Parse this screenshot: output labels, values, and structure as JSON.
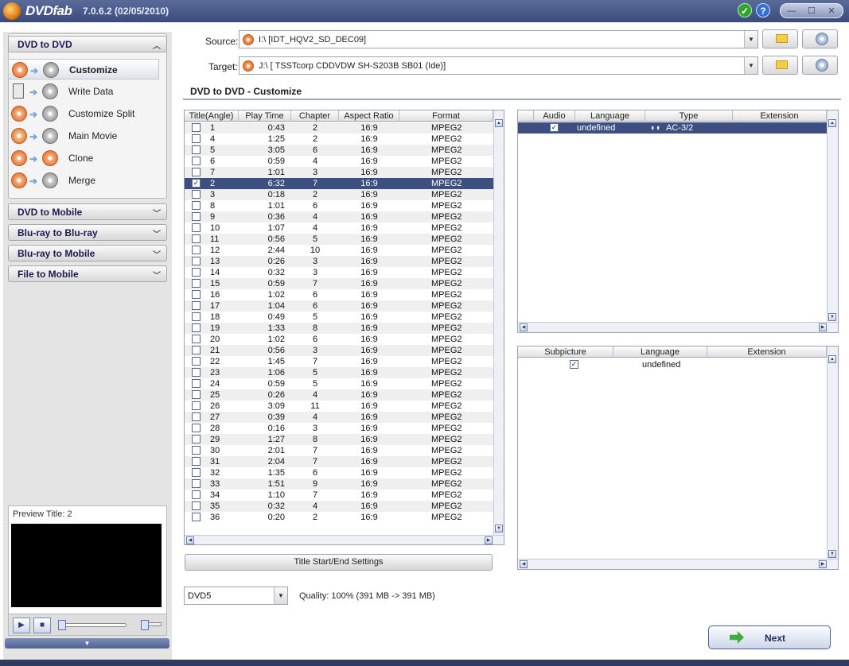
{
  "app": {
    "name": "DVDfab",
    "version": "7.0.6.2 (02/05/2010)"
  },
  "sidebar": {
    "main_category": "DVD to DVD",
    "modes": [
      {
        "label": "Customize",
        "selected": true
      },
      {
        "label": "Write Data",
        "selected": false
      },
      {
        "label": "Customize Split",
        "selected": false
      },
      {
        "label": "Main Movie",
        "selected": false
      },
      {
        "label": "Clone",
        "selected": false
      },
      {
        "label": "Merge",
        "selected": false
      }
    ],
    "categories": [
      "DVD to Mobile",
      "Blu-ray to Blu-ray",
      "Blu-ray to Mobile",
      "File to Mobile"
    ],
    "preview_label": "Preview Title: 2"
  },
  "source": {
    "label": "Source:",
    "value": "I:\\ [IDT_HQV2_SD_DEC09]"
  },
  "target": {
    "label": "Target:",
    "value": "J:\\ [ TSSTcorp CDDVDW SH-S203B SB01 (Ide)]"
  },
  "section_title": "DVD to DVD - Customize",
  "titles": {
    "headers": [
      "Title(Angle)",
      "Play Time",
      "Chapter",
      "Aspect Ratio",
      "Format"
    ],
    "rows": [
      {
        "title": "1",
        "time": "0:43",
        "chapters": "2",
        "aspect": "16:9",
        "format": "MPEG2",
        "checked": false
      },
      {
        "title": "4",
        "time": "1:25",
        "chapters": "2",
        "aspect": "16:9",
        "format": "MPEG2",
        "checked": false
      },
      {
        "title": "5",
        "time": "3:05",
        "chapters": "6",
        "aspect": "16:9",
        "format": "MPEG2",
        "checked": false
      },
      {
        "title": "6",
        "time": "0:59",
        "chapters": "4",
        "aspect": "16:9",
        "format": "MPEG2",
        "checked": false
      },
      {
        "title": "7",
        "time": "1:01",
        "chapters": "3",
        "aspect": "16:9",
        "format": "MPEG2",
        "checked": false
      },
      {
        "title": "2",
        "time": "6:32",
        "chapters": "7",
        "aspect": "16:9",
        "format": "MPEG2",
        "checked": true
      },
      {
        "title": "3",
        "time": "0:18",
        "chapters": "2",
        "aspect": "16:9",
        "format": "MPEG2",
        "checked": false
      },
      {
        "title": "8",
        "time": "1:01",
        "chapters": "6",
        "aspect": "16:9",
        "format": "MPEG2",
        "checked": false
      },
      {
        "title": "9",
        "time": "0:36",
        "chapters": "4",
        "aspect": "16:9",
        "format": "MPEG2",
        "checked": false
      },
      {
        "title": "10",
        "time": "1:07",
        "chapters": "4",
        "aspect": "16:9",
        "format": "MPEG2",
        "checked": false
      },
      {
        "title": "11",
        "time": "0:56",
        "chapters": "5",
        "aspect": "16:9",
        "format": "MPEG2",
        "checked": false
      },
      {
        "title": "12",
        "time": "2:44",
        "chapters": "10",
        "aspect": "16:9",
        "format": "MPEG2",
        "checked": false
      },
      {
        "title": "13",
        "time": "0:26",
        "chapters": "3",
        "aspect": "16:9",
        "format": "MPEG2",
        "checked": false
      },
      {
        "title": "14",
        "time": "0:32",
        "chapters": "3",
        "aspect": "16:9",
        "format": "MPEG2",
        "checked": false
      },
      {
        "title": "15",
        "time": "0:59",
        "chapters": "7",
        "aspect": "16:9",
        "format": "MPEG2",
        "checked": false
      },
      {
        "title": "16",
        "time": "1:02",
        "chapters": "6",
        "aspect": "16:9",
        "format": "MPEG2",
        "checked": false
      },
      {
        "title": "17",
        "time": "1:04",
        "chapters": "6",
        "aspect": "16:9",
        "format": "MPEG2",
        "checked": false
      },
      {
        "title": "18",
        "time": "0:49",
        "chapters": "5",
        "aspect": "16:9",
        "format": "MPEG2",
        "checked": false
      },
      {
        "title": "19",
        "time": "1:33",
        "chapters": "8",
        "aspect": "16:9",
        "format": "MPEG2",
        "checked": false
      },
      {
        "title": "20",
        "time": "1:02",
        "chapters": "6",
        "aspect": "16:9",
        "format": "MPEG2",
        "checked": false
      },
      {
        "title": "21",
        "time": "0:56",
        "chapters": "3",
        "aspect": "16:9",
        "format": "MPEG2",
        "checked": false
      },
      {
        "title": "22",
        "time": "1:45",
        "chapters": "7",
        "aspect": "16:9",
        "format": "MPEG2",
        "checked": false
      },
      {
        "title": "23",
        "time": "1:06",
        "chapters": "5",
        "aspect": "16:9",
        "format": "MPEG2",
        "checked": false
      },
      {
        "title": "24",
        "time": "0:59",
        "chapters": "5",
        "aspect": "16:9",
        "format": "MPEG2",
        "checked": false
      },
      {
        "title": "25",
        "time": "0:26",
        "chapters": "4",
        "aspect": "16:9",
        "format": "MPEG2",
        "checked": false
      },
      {
        "title": "26",
        "time": "3:09",
        "chapters": "11",
        "aspect": "16:9",
        "format": "MPEG2",
        "checked": false
      },
      {
        "title": "27",
        "time": "0:39",
        "chapters": "4",
        "aspect": "16:9",
        "format": "MPEG2",
        "checked": false
      },
      {
        "title": "28",
        "time": "0:16",
        "chapters": "3",
        "aspect": "16:9",
        "format": "MPEG2",
        "checked": false
      },
      {
        "title": "29",
        "time": "1:27",
        "chapters": "8",
        "aspect": "16:9",
        "format": "MPEG2",
        "checked": false
      },
      {
        "title": "30",
        "time": "2:01",
        "chapters": "7",
        "aspect": "16:9",
        "format": "MPEG2",
        "checked": false
      },
      {
        "title": "31",
        "time": "2:04",
        "chapters": "7",
        "aspect": "16:9",
        "format": "MPEG2",
        "checked": false
      },
      {
        "title": "32",
        "time": "1:35",
        "chapters": "6",
        "aspect": "16:9",
        "format": "MPEG2",
        "checked": false
      },
      {
        "title": "33",
        "time": "1:51",
        "chapters": "9",
        "aspect": "16:9",
        "format": "MPEG2",
        "checked": false
      },
      {
        "title": "34",
        "time": "1:10",
        "chapters": "7",
        "aspect": "16:9",
        "format": "MPEG2",
        "checked": false
      },
      {
        "title": "35",
        "time": "0:32",
        "chapters": "4",
        "aspect": "16:9",
        "format": "MPEG2",
        "checked": false
      },
      {
        "title": "36",
        "time": "0:20",
        "chapters": "2",
        "aspect": "16:9",
        "format": "MPEG2",
        "checked": false
      }
    ]
  },
  "audio": {
    "headers": [
      "Audio",
      "Language",
      "Type",
      "Extension"
    ],
    "rows": [
      {
        "checked": true,
        "language": "undefined",
        "type": "AC-3/2",
        "extension": ""
      }
    ]
  },
  "subpicture": {
    "headers": [
      "Subpicture",
      "Language",
      "Extension"
    ],
    "rows": [
      {
        "checked": true,
        "language": "undefined",
        "extension": ""
      }
    ]
  },
  "title_settings_button": "Title Start/End Settings",
  "output_size": "DVD5",
  "quality": "Quality: 100% (391 MB -> 391 MB)",
  "next_button": "Next",
  "colors": {
    "selection": "#3d4f81",
    "titlebar": "#4a5a8a",
    "next_arrow": "#3fae3f"
  }
}
